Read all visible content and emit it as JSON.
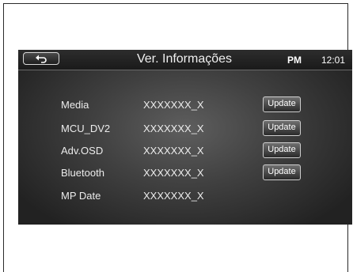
{
  "header": {
    "title": "Ver. Informações",
    "ampm": "PM",
    "time": "12:01",
    "back_icon": "back-arrow-icon"
  },
  "rows": [
    {
      "label": "Media",
      "value": "XXXXXXX_X",
      "button": "Update"
    },
    {
      "label": "MCU_DV2",
      "value": "XXXXXXX_X",
      "button": "Update"
    },
    {
      "label": "Adv.OSD",
      "value": "XXXXXXX_X",
      "button": "Update"
    },
    {
      "label": "Bluetooth",
      "value": "XXXXXXX_X",
      "button": "Update"
    },
    {
      "label": "MP Date",
      "value": "XXXXXXX_X"
    }
  ]
}
